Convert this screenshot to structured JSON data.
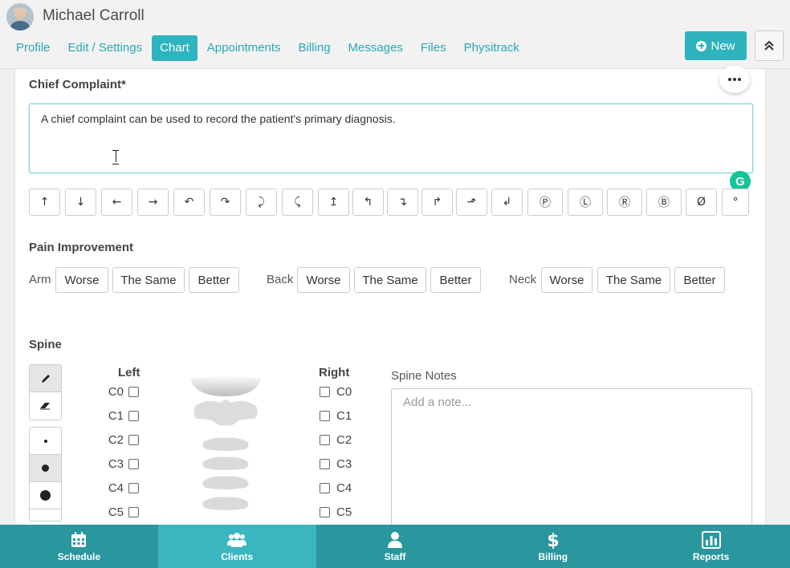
{
  "header": {
    "patient_name": "Michael Carroll",
    "new_button_label": "New",
    "tabs": [
      {
        "label": "Profile"
      },
      {
        "label": "Edit / Settings"
      },
      {
        "label": "Chart",
        "active": true
      },
      {
        "label": "Appointments"
      },
      {
        "label": "Billing"
      },
      {
        "label": "Messages"
      },
      {
        "label": "Files"
      },
      {
        "label": "Physitrack"
      }
    ]
  },
  "chief_complaint": {
    "label": "Chief Complaint*",
    "text": "A chief complaint can be used to record the patient's primary diagnosis."
  },
  "symbols": [
    "↑",
    "↓",
    "←",
    "→",
    "↶",
    "↷",
    "⤸",
    "⤹",
    "↥",
    "↰",
    "↴",
    "↱",
    "⬏",
    "↲",
    "Ⓟ",
    "Ⓛ",
    "Ⓡ",
    "Ⓑ",
    "Ø",
    "°"
  ],
  "pain_improvement": {
    "label": "Pain Improvement",
    "groups": [
      {
        "label": "Arm",
        "options": [
          "Worse",
          "The Same",
          "Better"
        ]
      },
      {
        "label": "Back",
        "options": [
          "Worse",
          "The Same",
          "Better"
        ]
      },
      {
        "label": "Neck",
        "options": [
          "Worse",
          "The Same",
          "Better"
        ]
      }
    ]
  },
  "spine": {
    "label": "Spine",
    "left_label": "Left",
    "right_label": "Right",
    "vertebrae": [
      "C0",
      "C1",
      "C2",
      "C3",
      "C4",
      "C5"
    ],
    "notes_label": "Spine Notes",
    "notes_placeholder": "Add a note..."
  },
  "bottom_nav": [
    {
      "label": "Schedule",
      "icon": "calendar-icon"
    },
    {
      "label": "Clients",
      "icon": "users-icon",
      "active": true
    },
    {
      "label": "Staff",
      "icon": "user-icon"
    },
    {
      "label": "Billing",
      "icon": "dollar-icon"
    },
    {
      "label": "Reports",
      "icon": "bar-chart-icon"
    }
  ],
  "colors": {
    "accent": "#2fb3be",
    "bottom_nav": "#2a979f",
    "bottom_nav_active": "#3ab6c0"
  }
}
